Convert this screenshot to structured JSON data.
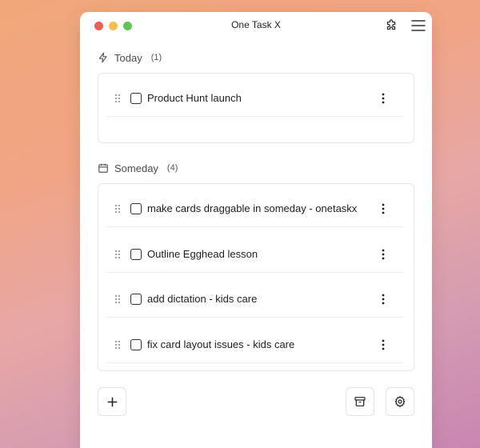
{
  "window": {
    "title": "One Task X"
  },
  "icons": {
    "extension": "puzzle-icon",
    "menu": "hamburger-menu-icon",
    "today": "lightning-icon",
    "someday": "calendar-icon",
    "drag": "drag-handle-icon",
    "more": "more-vertical-icon",
    "add": "plus-icon",
    "archive": "archive-icon",
    "settings": "gear-icon"
  },
  "today": {
    "label": "Today",
    "count": "(1)",
    "tasks": [
      {
        "label": "Product Hunt launch",
        "checked": false
      }
    ]
  },
  "someday": {
    "label": "Someday",
    "count": "(4)",
    "tasks": [
      {
        "label": "make cards draggable in someday - onetaskx",
        "checked": false
      },
      {
        "label": "Outline Egghead lesson",
        "checked": false
      },
      {
        "label": "add dictation - kids care",
        "checked": false
      },
      {
        "label": "fix card layout issues - kids care",
        "checked": false
      }
    ]
  },
  "colors": {
    "close": "#ec5f57",
    "minimize": "#f4bf4f",
    "maximize": "#61c554"
  }
}
